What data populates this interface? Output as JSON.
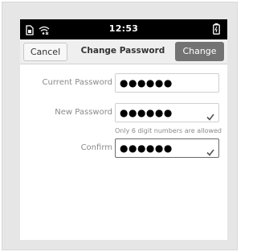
{
  "status_bar": {
    "time": "12:53",
    "icons": [
      "sim-no-service-icon",
      "wifi-disconnected-icon",
      "battery-charging-icon"
    ]
  },
  "header": {
    "cancel_label": "Cancel",
    "title": "Change Password",
    "change_label": "Change"
  },
  "form": {
    "current_password": {
      "label": "Current Password",
      "value": "●●●●●●"
    },
    "new_password": {
      "label": "New Password",
      "value": "●●●●●●"
    },
    "hint": "Only 6 digit numbers are allowed",
    "confirm": {
      "label": "Confirm",
      "value": "●●●●●●"
    }
  },
  "colors": {
    "status_bar_bg": "#000000",
    "header_bg": "#efefef",
    "primary_button_bg": "#737373",
    "label_text": "#8a8a8a"
  }
}
